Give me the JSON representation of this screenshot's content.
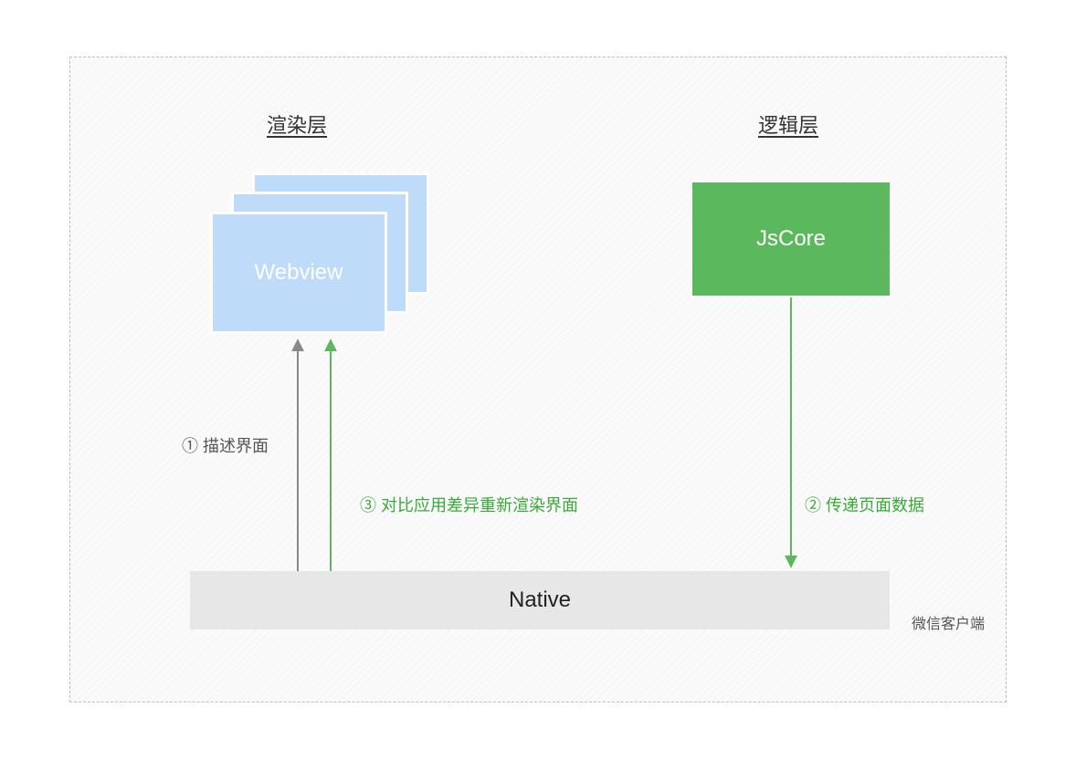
{
  "headings": {
    "render_layer": "渲染层",
    "logic_layer": "逻辑层"
  },
  "boxes": {
    "webview": "Webview",
    "jscore": "JsCore",
    "native": "Native"
  },
  "labels": {
    "step1": "① 描述界面",
    "step2": "② 传递页面数据",
    "step3": "③ 对比应用差异重新渲染界面"
  },
  "footer": "微信客户端",
  "colors": {
    "webview_fill": "#bedcf9",
    "jscore_fill": "#5cb85c",
    "native_fill": "#e7e7e7",
    "arrow_gray": "#888888",
    "arrow_green": "#5cb85c",
    "text_green": "#39a939"
  }
}
